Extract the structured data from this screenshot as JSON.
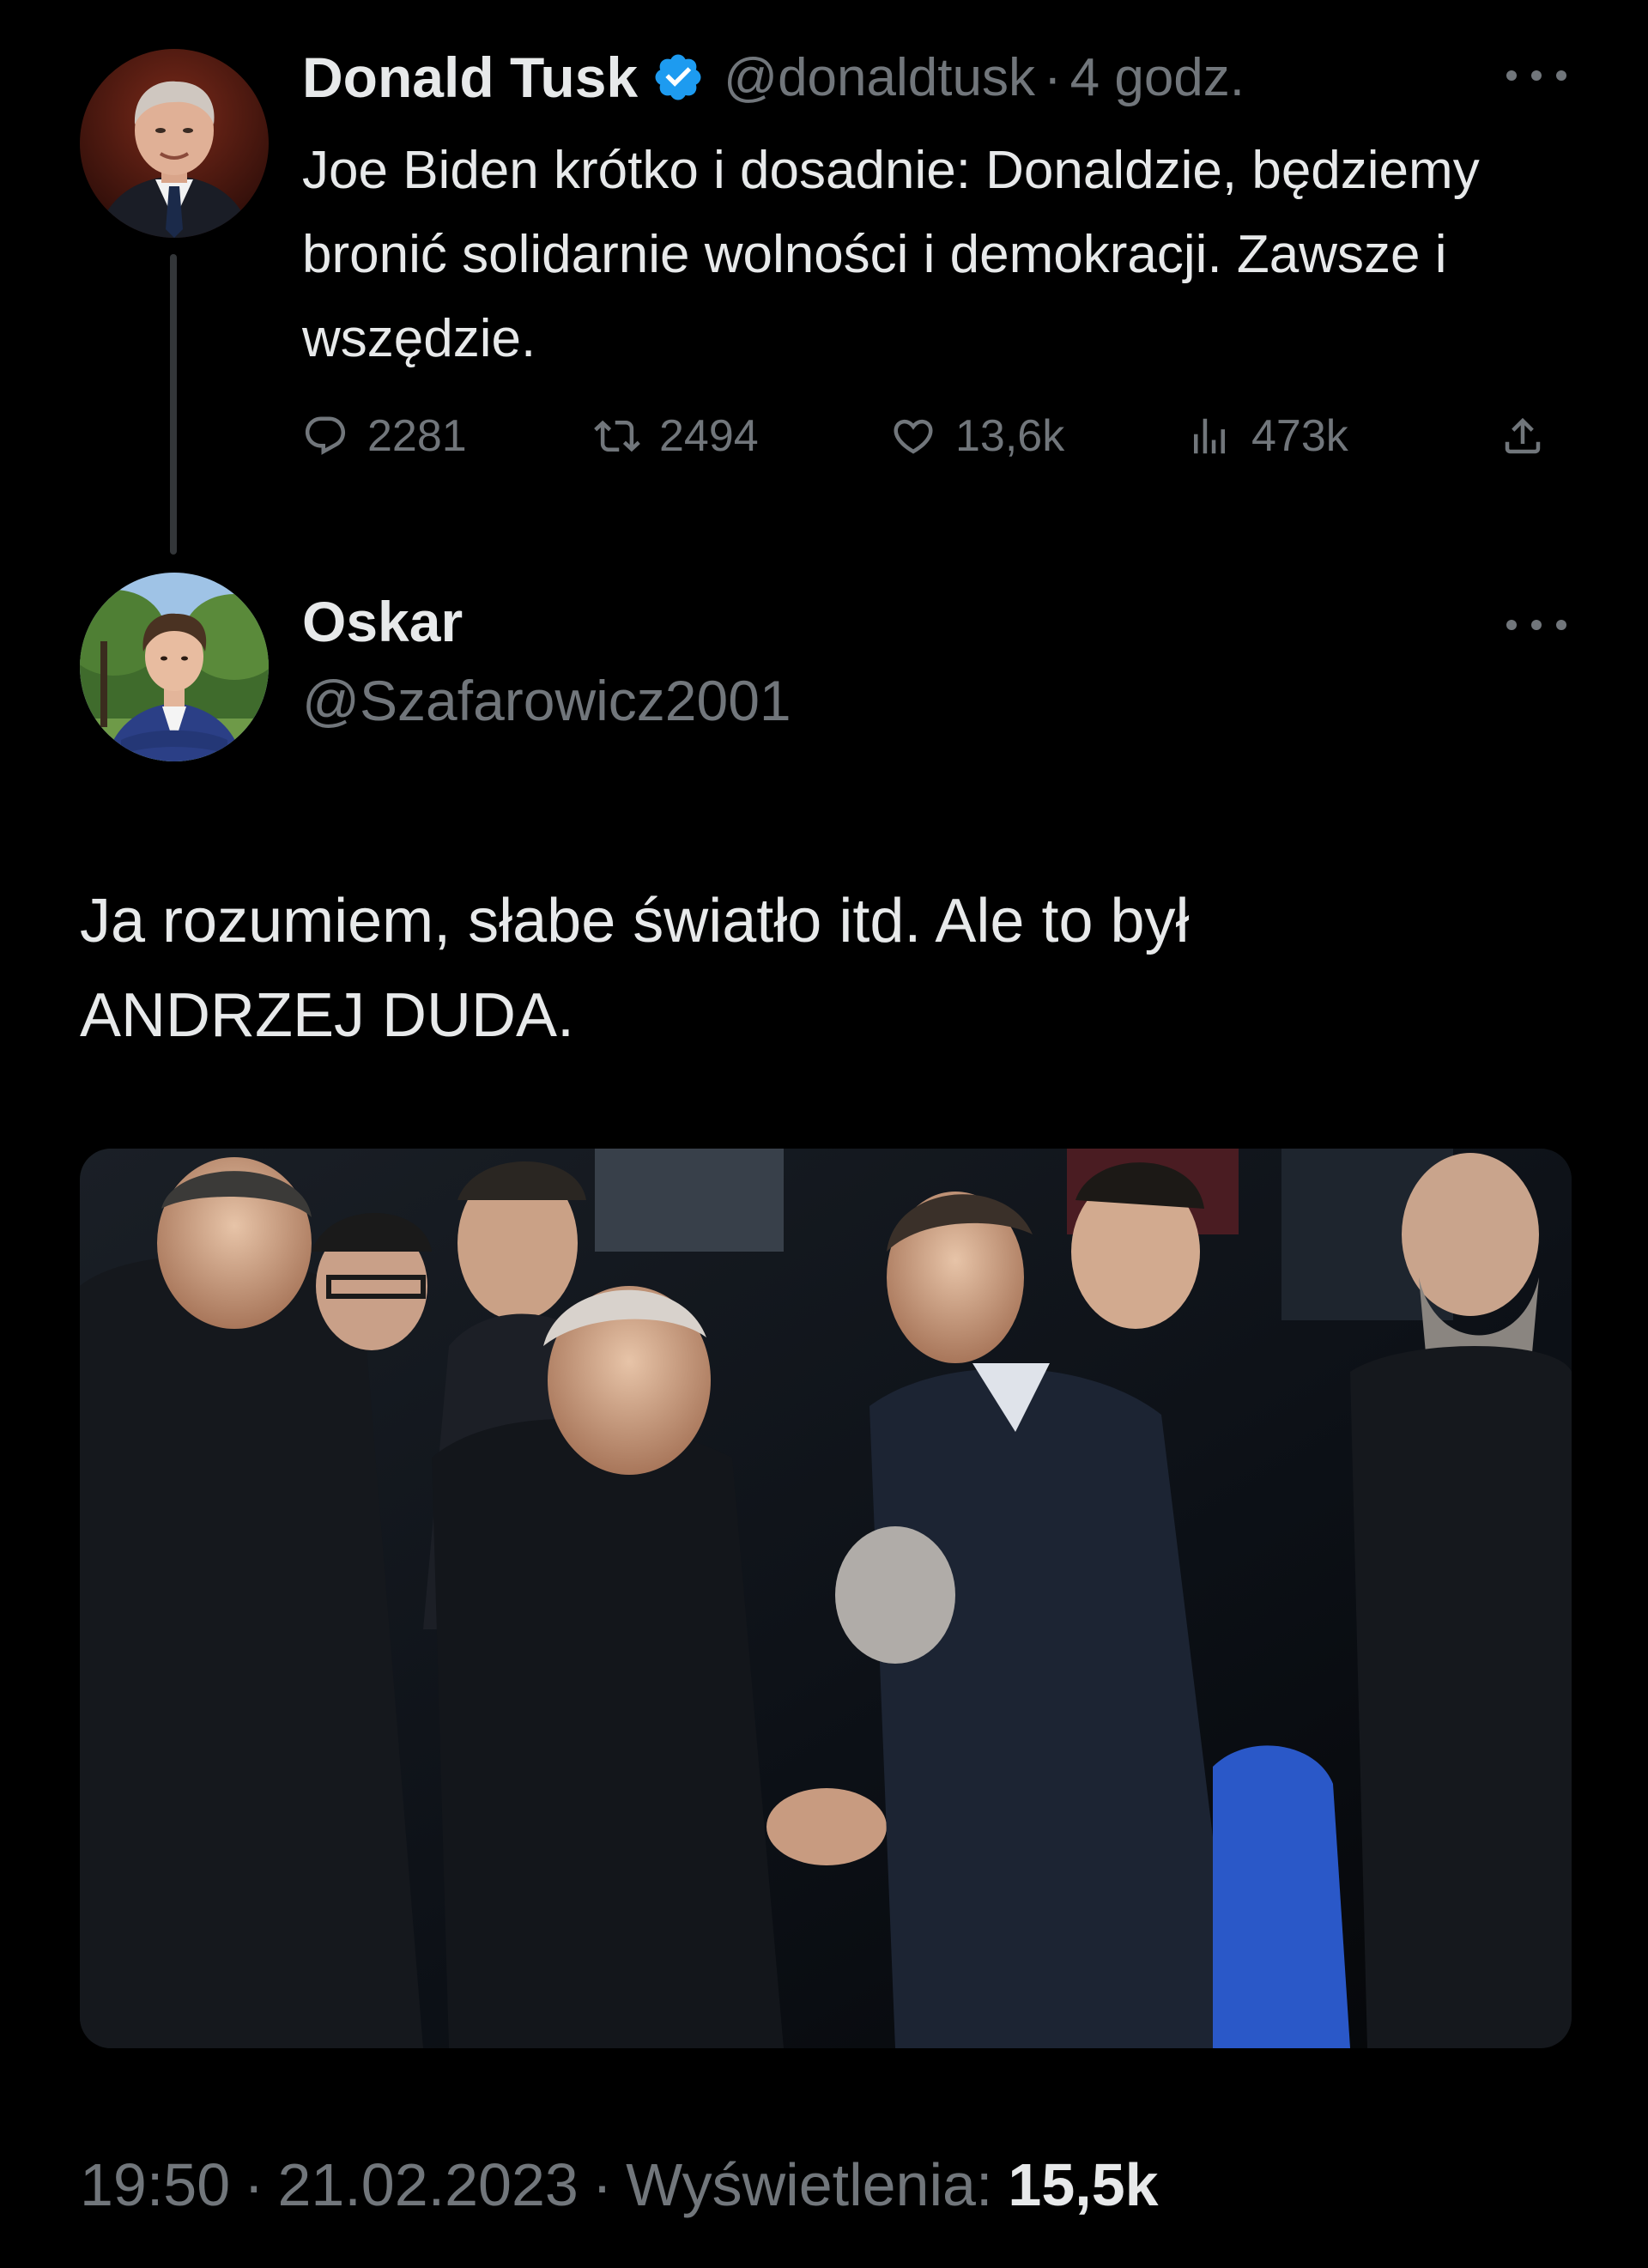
{
  "parent_tweet": {
    "display_name": "Donald Tusk",
    "handle": "@donaldtusk",
    "separator": "·",
    "time_ago": "4 godz.",
    "text": "Joe Biden krótko i dosadnie: Donaldzie, będziemy bronić solidarnie wolności i demokracji. Zawsze i wszędzie.",
    "verified": true,
    "stats": {
      "replies": "2281",
      "retweets": "2494",
      "likes": "13,6k",
      "views": "473k"
    }
  },
  "main_tweet": {
    "display_name": "Oskar",
    "handle": "@Szafarowicz2001",
    "text_line1": "Ja rozumiem, słabe światło itd. Ale to był",
    "text_line2": "ANDRZEJ DUDA.",
    "time": "19:50",
    "separator": "·",
    "date": "21.02.2023",
    "views_label": "Wyświetlenia:",
    "views_count": "15,5k"
  },
  "icons": {
    "reply": "reply-icon",
    "retweet": "retweet-icon",
    "like": "heart-icon",
    "views": "views-icon",
    "share": "share-icon",
    "verified": "verified-badge-icon",
    "more": "more-options-icon"
  },
  "colors": {
    "background": "#000000",
    "primary_text": "#e7e9ea",
    "secondary_text": "#71767b",
    "verified": "#1d9bf0",
    "thread_line": "#333639"
  }
}
